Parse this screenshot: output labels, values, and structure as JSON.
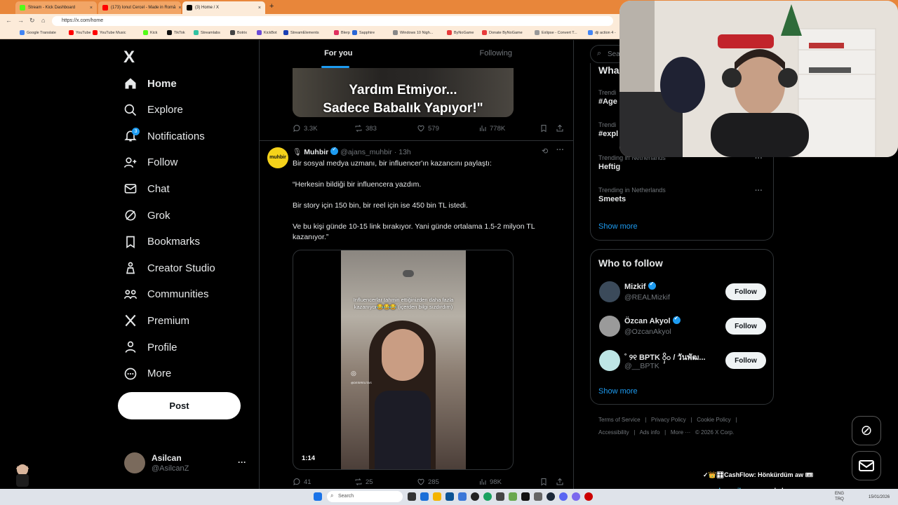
{
  "browser": {
    "tabs": [
      {
        "title": "Stream - Kick Dashboard",
        "color": "#53fc18"
      },
      {
        "title": "(173) Ionut Cercel - Made in Româ",
        "color": "#ff0000"
      },
      {
        "title": "(3) Home / X",
        "color": "#000000"
      }
    ],
    "new_tab": "+",
    "url": "https://x.com/home",
    "bookmarks": [
      {
        "label": "Google Translate",
        "color": "#4285f4"
      },
      {
        "label": "YouTube",
        "color": "#ff0000"
      },
      {
        "label": "YouTube Music",
        "color": "#ff0000"
      },
      {
        "label": "Kick",
        "color": "#53fc18"
      },
      {
        "label": "TikTok",
        "color": "#111111"
      },
      {
        "label": "Streamlabs",
        "color": "#31c3a2"
      },
      {
        "label": "Botrix",
        "color": "#444444"
      },
      {
        "label": "KickBot",
        "color": "#6b4bd6"
      },
      {
        "label": "StreamElements",
        "color": "#1a3fb4"
      },
      {
        "label": "Blerp",
        "color": "#e02e5e"
      },
      {
        "label": "Sapphire",
        "color": "#2966d6"
      },
      {
        "label": "Windows 10 Nigh...",
        "color": "#888888"
      },
      {
        "label": "ByNoGame",
        "color": "#e83a3a"
      },
      {
        "label": "Donate ByNoGame",
        "color": "#e83a3a"
      },
      {
        "label": "Exlipse - Convert T...",
        "color": "#999999"
      },
      {
        "label": "dji action 4 -",
        "color": "#4285f4"
      }
    ]
  },
  "nav": {
    "logo": "X",
    "items": [
      {
        "label": "Home",
        "icon": "home-icon"
      },
      {
        "label": "Explore",
        "icon": "search-icon"
      },
      {
        "label": "Notifications",
        "icon": "bell-icon"
      },
      {
        "label": "Follow",
        "icon": "person-plus-icon"
      },
      {
        "label": "Chat",
        "icon": "mail-icon"
      },
      {
        "label": "Grok",
        "icon": "grok-icon"
      },
      {
        "label": "Bookmarks",
        "icon": "bookmark-icon"
      },
      {
        "label": "Creator Studio",
        "icon": "creator-icon"
      },
      {
        "label": "Communities",
        "icon": "communities-icon"
      },
      {
        "label": "Premium",
        "icon": "x-icon"
      },
      {
        "label": "Profile",
        "icon": "profile-icon"
      },
      {
        "label": "More",
        "icon": "more-circle-icon"
      }
    ],
    "notifications_badge": "3",
    "post_button": "Post",
    "account": {
      "name": "Asilcan",
      "handle": "@AsilcanZ",
      "menu": "···"
    }
  },
  "feed": {
    "tabs": [
      "For you",
      "Following"
    ],
    "tweet1": {
      "image_caption_line1": "Yardım Etmiyor...",
      "image_caption_line2": "Sadece Babalık Yapıyor!\"",
      "replies": "3.3K",
      "reposts": "383",
      "likes": "579",
      "views": "778K"
    },
    "tweet2": {
      "avatar_text": "muhbir",
      "name": "Muhbir",
      "handle": "@ajans_muhbir",
      "time": "· 13h",
      "text1": "Bir sosyal medya uzmanı, bir influencer'ın kazancını paylaştı:",
      "text2": "“Herkesin bildiği bir influencera yazdım.",
      "text3": "Bir story için 150 bin, bir reel için ise 450 bin TL istedi.",
      "text4": "Ve bu kişi günde 10-15 link bırakıyor. Yani günde ortalama 1.5-2 milyon TL kazanıyor.”",
      "video_overlay": "Influencerlar tahmin ettiğinizden daha fazla kazanıyor😂😂😂 (içerden bilgi sızdırdım)",
      "video_watermark": "@DESIRELITAS",
      "video_duration": "1:14",
      "replies": "41",
      "reposts": "25",
      "likes": "285",
      "views": "98K"
    }
  },
  "right": {
    "search_placeholder": "Sea",
    "whats_happening_partial": "Wha",
    "trends": [
      {
        "context": "Trendi",
        "title": "#Age"
      },
      {
        "context": "Trendi",
        "title": "#expl"
      },
      {
        "context": "Trending in Netherlands",
        "title": "Heftig"
      },
      {
        "context": "Trending in Netherlands",
        "title": "Smeets"
      }
    ],
    "show_more": "Show more",
    "who_to_follow_title": "Who to follow",
    "who_to_follow": [
      {
        "name": "Mizkif",
        "handle": "@REALMizkif",
        "verified": true,
        "button": "Follow"
      },
      {
        "name": "Özcan Akyol",
        "handle": "@OzcanAkyol",
        "verified": true,
        "button": "Follow"
      },
      {
        "name": "˚ ୨୧ BPTK ၀ှိ၀ / วันพัฒ...",
        "handle": "@__BPTK",
        "verified": false,
        "button": "Follow"
      }
    ],
    "footer": [
      "Terms of Service",
      "|",
      "Privacy Policy",
      "|",
      "Cookie Policy",
      "|",
      "Accessibility",
      "|",
      "Ads info",
      "|",
      "More ···",
      "© 2026 X Corp."
    ]
  },
  "overlays": {
    "chat_line1": "✓👑🎛CashFlow: Hönkürdüm aw 🎟",
    "chat_line2_name": "surodenayrilan:",
    "chat_line2_text": "yersen haber",
    "grok_fab": "grok-icon",
    "messages_fab": "mail-icon"
  },
  "taskbar": {
    "search": "Search",
    "lang": "ENG",
    "region": "TRQ",
    "time": "",
    "date": "15/01/2026"
  }
}
